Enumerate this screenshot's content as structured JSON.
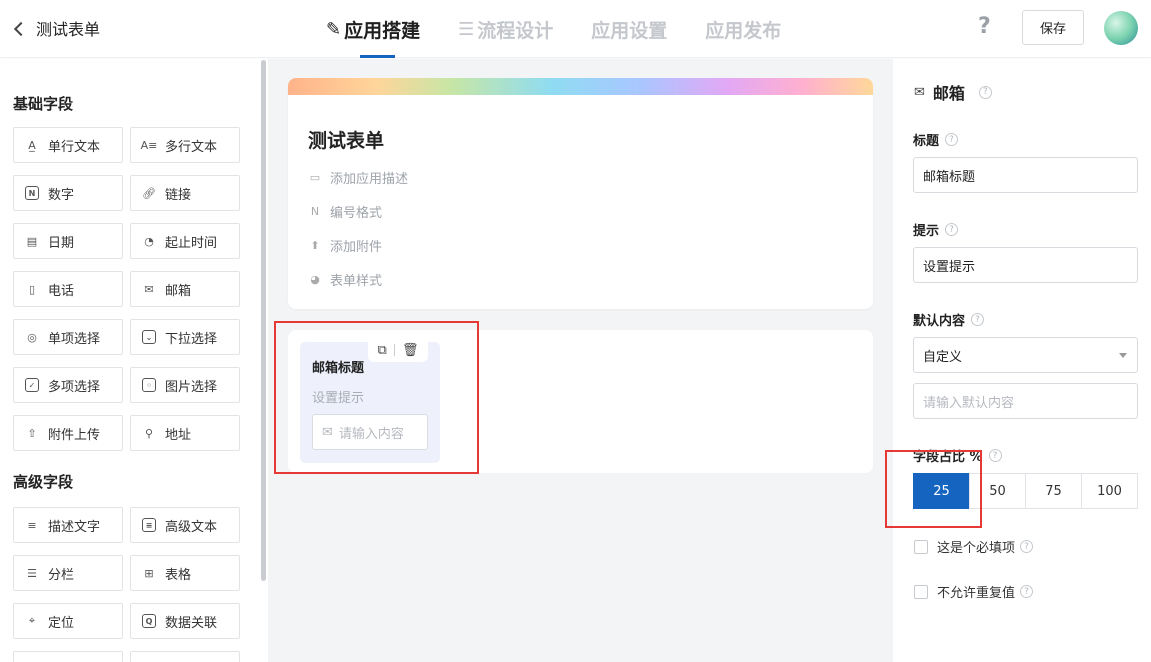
{
  "header": {
    "back_title": "测试表单",
    "tabs": [
      {
        "icon": "✎",
        "label": "应用搭建",
        "active": true
      },
      {
        "icon": "☰",
        "label": "流程设计",
        "active": false
      },
      {
        "icon": "",
        "label": "应用设置",
        "active": false
      },
      {
        "icon": "",
        "label": "应用发布",
        "active": false
      }
    ],
    "help_glyph": "?",
    "save_label": "保存"
  },
  "sidebar": {
    "basic_title": "基础字段",
    "basic_fields": [
      "单行文本",
      "多行文本",
      "数字",
      "链接",
      "日期",
      "起止时间",
      "电话",
      "邮箱",
      "单项选择",
      "下拉选择",
      "多项选择",
      "图片选择",
      "附件上传",
      "地址"
    ],
    "advanced_title": "高级字段",
    "advanced_fields": [
      "描述文字",
      "高级文本",
      "分栏",
      "表格",
      "定位",
      "数据关联"
    ]
  },
  "form": {
    "title": "测试表单",
    "meta": [
      "添加应用描述",
      "编号格式",
      "添加附件",
      "表单样式"
    ],
    "field_card": {
      "title": "邮箱标题",
      "hint": "设置提示",
      "placeholder": "请输入内容"
    }
  },
  "panel": {
    "title": "邮箱",
    "label_title": "标题",
    "title_value": "邮箱标题",
    "label_hint": "提示",
    "hint_value": "设置提示",
    "label_default": "默认内容",
    "default_select": "自定义",
    "default_placeholder": "请输入默认内容",
    "label_ratio": "字段占比 %",
    "ratio_options": [
      "25",
      "50",
      "75",
      "100"
    ],
    "ratio_selected": "25",
    "required_label": "这是个必填项",
    "unique_label": "不允许重复值"
  },
  "colors": {
    "accent": "#1565c0",
    "highlight_box": "#e53935"
  }
}
